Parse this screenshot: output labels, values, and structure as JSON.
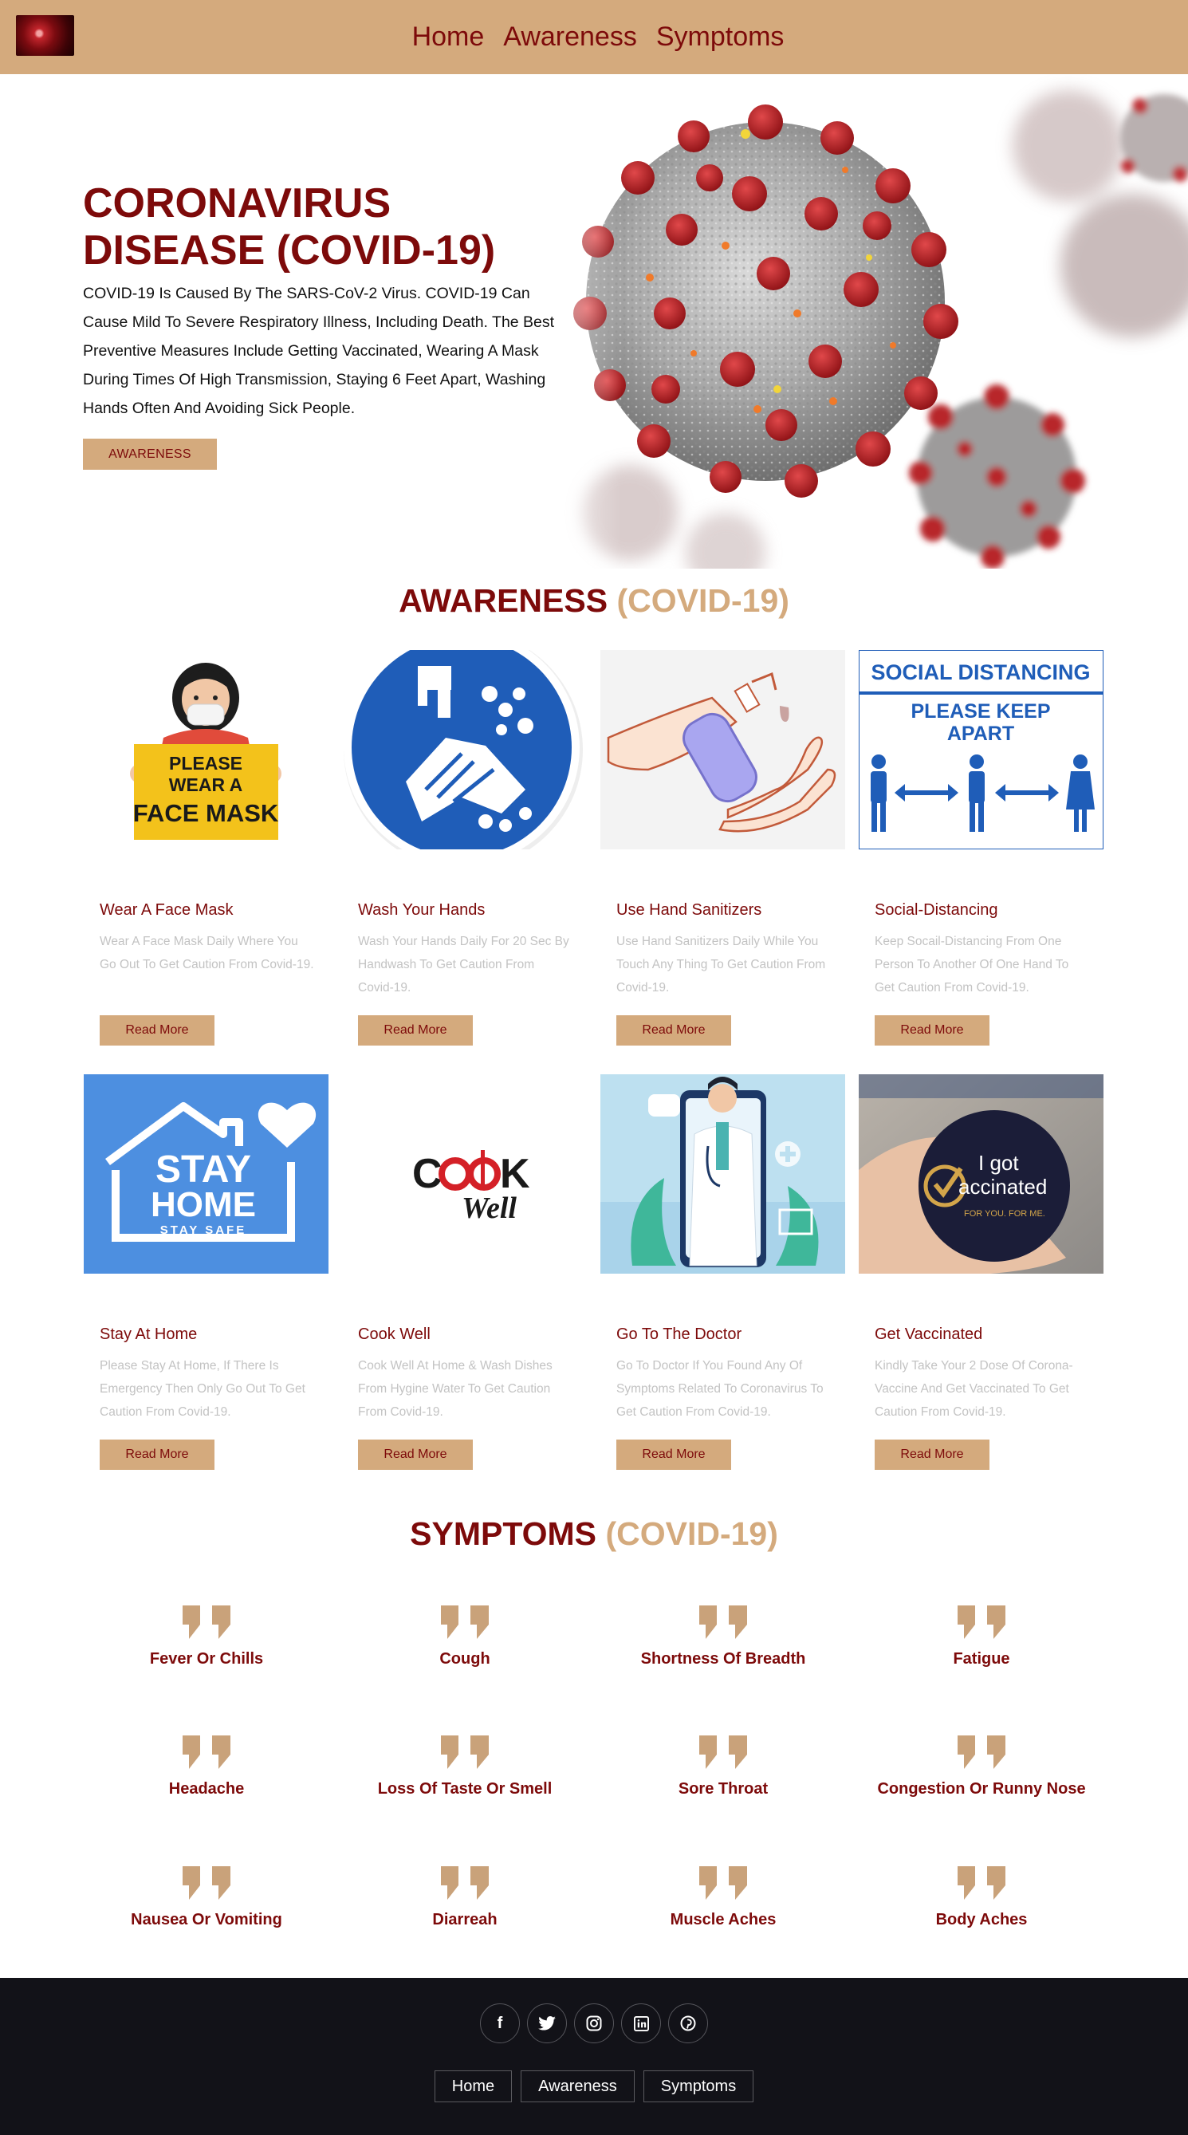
{
  "nav": {
    "logo_icon": "virus-logo-icon",
    "links": [
      "Home",
      "Awareness",
      "Symptoms"
    ]
  },
  "hero": {
    "title": "CORONAVIRUS DISEASE (COVID-19)",
    "text": "COVID-19 Is Caused By The SARS-CoV-2 Virus. COVID-19 Can Cause Mild To Severe Respiratory Illness, Including Death. The Best Preventive Measures Include Getting Vaccinated, Wearing A Mask During Times Of High Transmission, Staying 6 Feet Apart, Washing Hands Often And Avoiding Sick People.",
    "button": "AWARENESS"
  },
  "awareness": {
    "title_main": "AWARENESS",
    "title_accent": "(COVID-19)",
    "cards": [
      {
        "title": "Wear A Face Mask",
        "text": "Wear A Face Mask Daily Where You Go Out To Get Caution From Covid-19.",
        "button": "Read More",
        "image_text": [
          "PLEASE",
          "WEAR A",
          "FACE MASK"
        ]
      },
      {
        "title": "Wash Your Hands",
        "text": "Wash Your Hands Daily For 20 Sec By Handwash To Get Caution From Covid-19.",
        "button": "Read More"
      },
      {
        "title": "Use Hand Sanitizers",
        "text": "Use Hand Sanitizers Daily While You Touch Any Thing To Get Caution From Covid-19.",
        "button": "Read More"
      },
      {
        "title": "Social-Distancing",
        "text": "Keep Socail-Distancing From One Person To Another Of One Hand To Get Caution From Covid-19.",
        "button": "Read More",
        "image_text": [
          "SOCIAL DISTANCING",
          "PLEASE KEEP",
          "APART"
        ]
      },
      {
        "title": "Stay At Home",
        "text": "Please Stay At Home, If There Is Emergency Then Only Go Out To Get Caution From Covid-19.",
        "button": "Read More",
        "image_text": [
          "STAY",
          "HOME",
          "STAY SAFE"
        ]
      },
      {
        "title": "Cook Well",
        "text": "Cook Well At Home & Wash Dishes From Hygine Water To Get Caution From Covid-19.",
        "button": "Read More",
        "image_text": [
          "C",
          "K",
          "Well"
        ]
      },
      {
        "title": "Go To The Doctor",
        "text": "Go To Doctor If You Found Any Of Symptoms Related To Coronavirus To Get Caution From Covid-19.",
        "button": "Read More"
      },
      {
        "title": "Get Vaccinated",
        "text": "Kindly Take Your 2 Dose Of Corona-Vaccine And Get Vaccinated To Get Caution From Covid-19.",
        "button": "Read More",
        "image_text": [
          "I got",
          "accinated",
          "FOR YOU. FOR ME."
        ]
      }
    ]
  },
  "symptoms": {
    "title_main": "SYMPTOMS",
    "title_accent": "(COVID-19)",
    "items": [
      "Fever Or Chills",
      "Cough",
      "Shortness Of Breadth",
      "Fatigue",
      "Headache",
      "Loss Of Taste Or Smell",
      "Sore Throat",
      "Congestion Or Runny Nose",
      "Nausea Or Vomiting",
      "Diarreah",
      "Muscle Aches",
      "Body Aches"
    ]
  },
  "footer": {
    "social": [
      {
        "icon": "facebook-icon",
        "glyph": "f"
      },
      {
        "icon": "twitter-icon",
        "glyph": "🐦"
      },
      {
        "icon": "instagram-icon",
        "glyph": "◎"
      },
      {
        "icon": "linkedin-icon",
        "glyph": "in"
      },
      {
        "icon": "pinterest-icon",
        "glyph": "P"
      }
    ],
    "links": [
      "Home",
      "Awareness",
      "Symptoms"
    ]
  },
  "colors": {
    "brand_dark": "#7d0a0a",
    "brand_tan": "#d4aa7d",
    "footer_bg": "#121218"
  }
}
